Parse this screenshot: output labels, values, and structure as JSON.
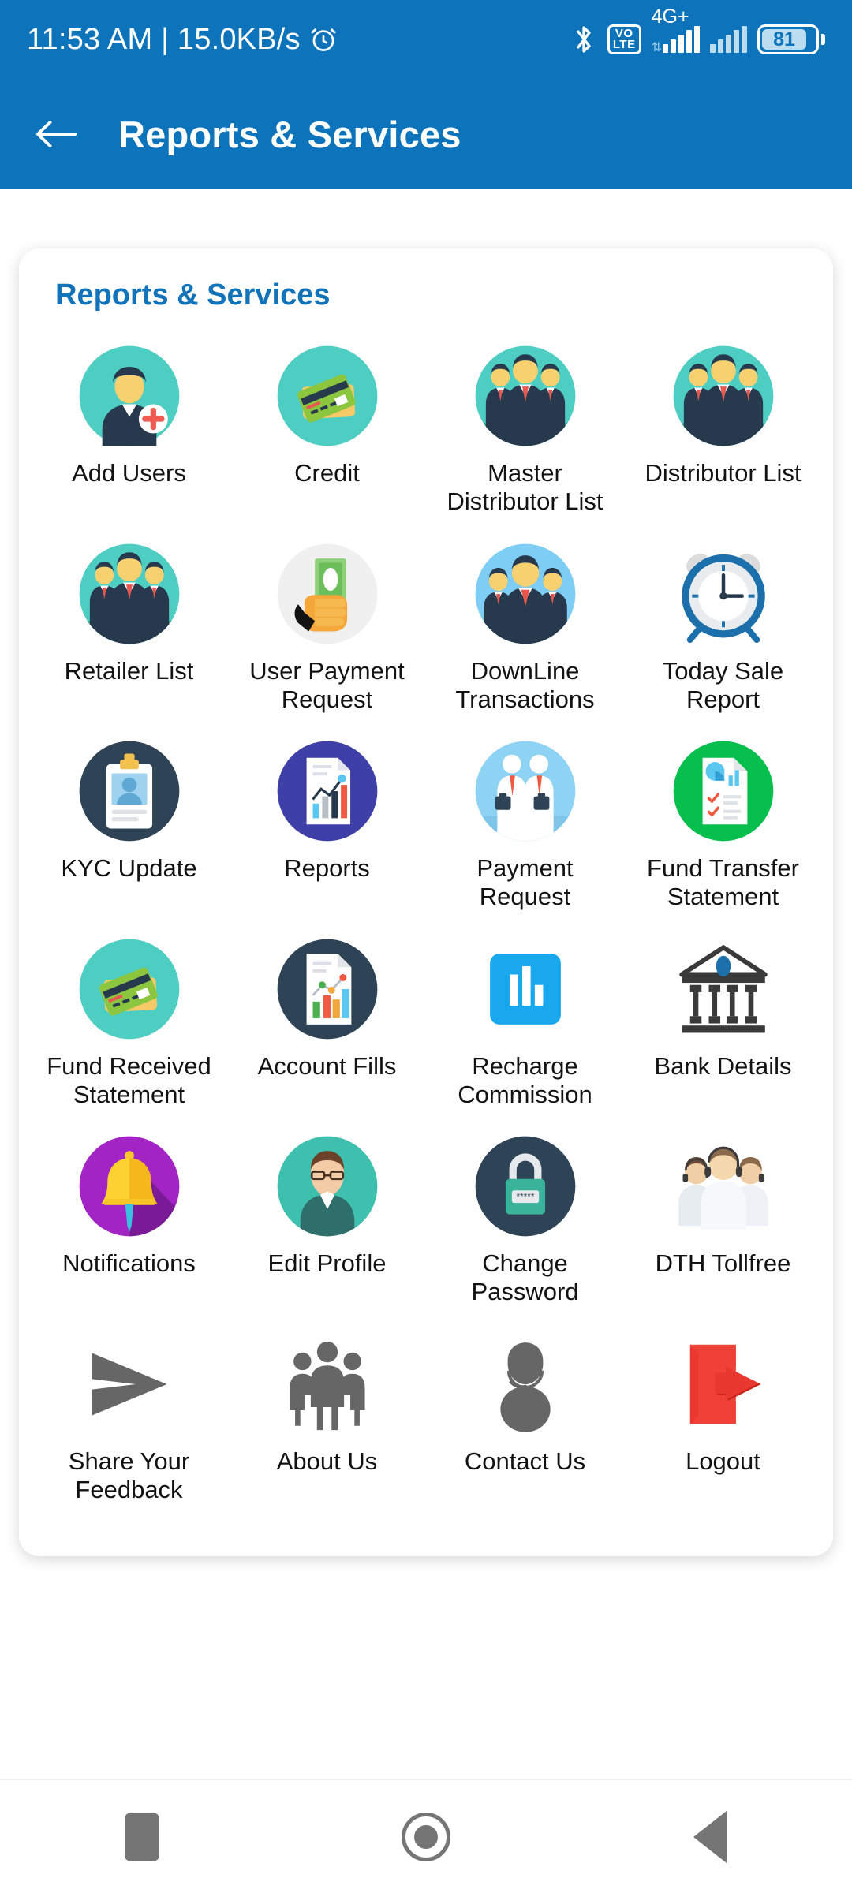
{
  "status_bar": {
    "time_and_speed": "11:53 AM | 15.0KB/s",
    "alarm_icon": "alarm-clock-icon",
    "bluetooth_icon": "bluetooth-icon",
    "volte_top": "VO",
    "volte_bottom": "LTE",
    "network_label": "4G+",
    "battery_level": "81"
  },
  "app_bar": {
    "back_icon": "back-arrow-icon",
    "title": "Reports & Services"
  },
  "card": {
    "title": "Reports & Services",
    "title_color": "#1273b8",
    "items": [
      {
        "label": "Add Users",
        "icon": "add-user-icon"
      },
      {
        "label": "Credit",
        "icon": "credit-cards-icon"
      },
      {
        "label": "Master Distributor List",
        "icon": "businessmen-group-icon"
      },
      {
        "label": "Distributor List",
        "icon": "businessmen-group-icon"
      },
      {
        "label": "Retailer List",
        "icon": "businessmen-group-icon"
      },
      {
        "label": "User Payment Request",
        "icon": "hand-holding-money-icon"
      },
      {
        "label": "DownLine Transactions",
        "icon": "team-people-icon"
      },
      {
        "label": "Today Sale Report",
        "icon": "alarm-clock-icon"
      },
      {
        "label": "KYC Update",
        "icon": "id-card-icon"
      },
      {
        "label": "Reports",
        "icon": "report-chart-document-icon"
      },
      {
        "label": "Payment Request",
        "icon": "two-businessmen-briefcase-icon"
      },
      {
        "label": "Fund Transfer Statement",
        "icon": "checklist-pie-document-icon"
      },
      {
        "label": "Fund Received Statement",
        "icon": "credit-cards-icon"
      },
      {
        "label": "Account Fills",
        "icon": "bar-chart-document-icon"
      },
      {
        "label": "Recharge Commission",
        "icon": "bar-chart-square-icon"
      },
      {
        "label": "Bank Details",
        "icon": "bank-building-icon"
      },
      {
        "label": "Notifications",
        "icon": "bell-icon"
      },
      {
        "label": "Edit Profile",
        "icon": "person-glasses-icon"
      },
      {
        "label": "Change Password",
        "icon": "padlock-icon"
      },
      {
        "label": "DTH Tollfree",
        "icon": "headset-support-team-icon"
      },
      {
        "label": "Share Your Feedback",
        "icon": "share-arrow-icon"
      },
      {
        "label": "About Us",
        "icon": "people-group-icon"
      },
      {
        "label": "Contact Us",
        "icon": "headset-person-icon"
      },
      {
        "label": "Logout",
        "icon": "logout-door-icon"
      }
    ]
  },
  "nav_bar": {
    "recents": "recents-square-icon",
    "home": "home-circle-icon",
    "back": "back-triangle-icon"
  },
  "colors": {
    "header_blue": "#0d74bb",
    "accent_teal": "#4ecdc4",
    "page_background": "#ffffff"
  }
}
